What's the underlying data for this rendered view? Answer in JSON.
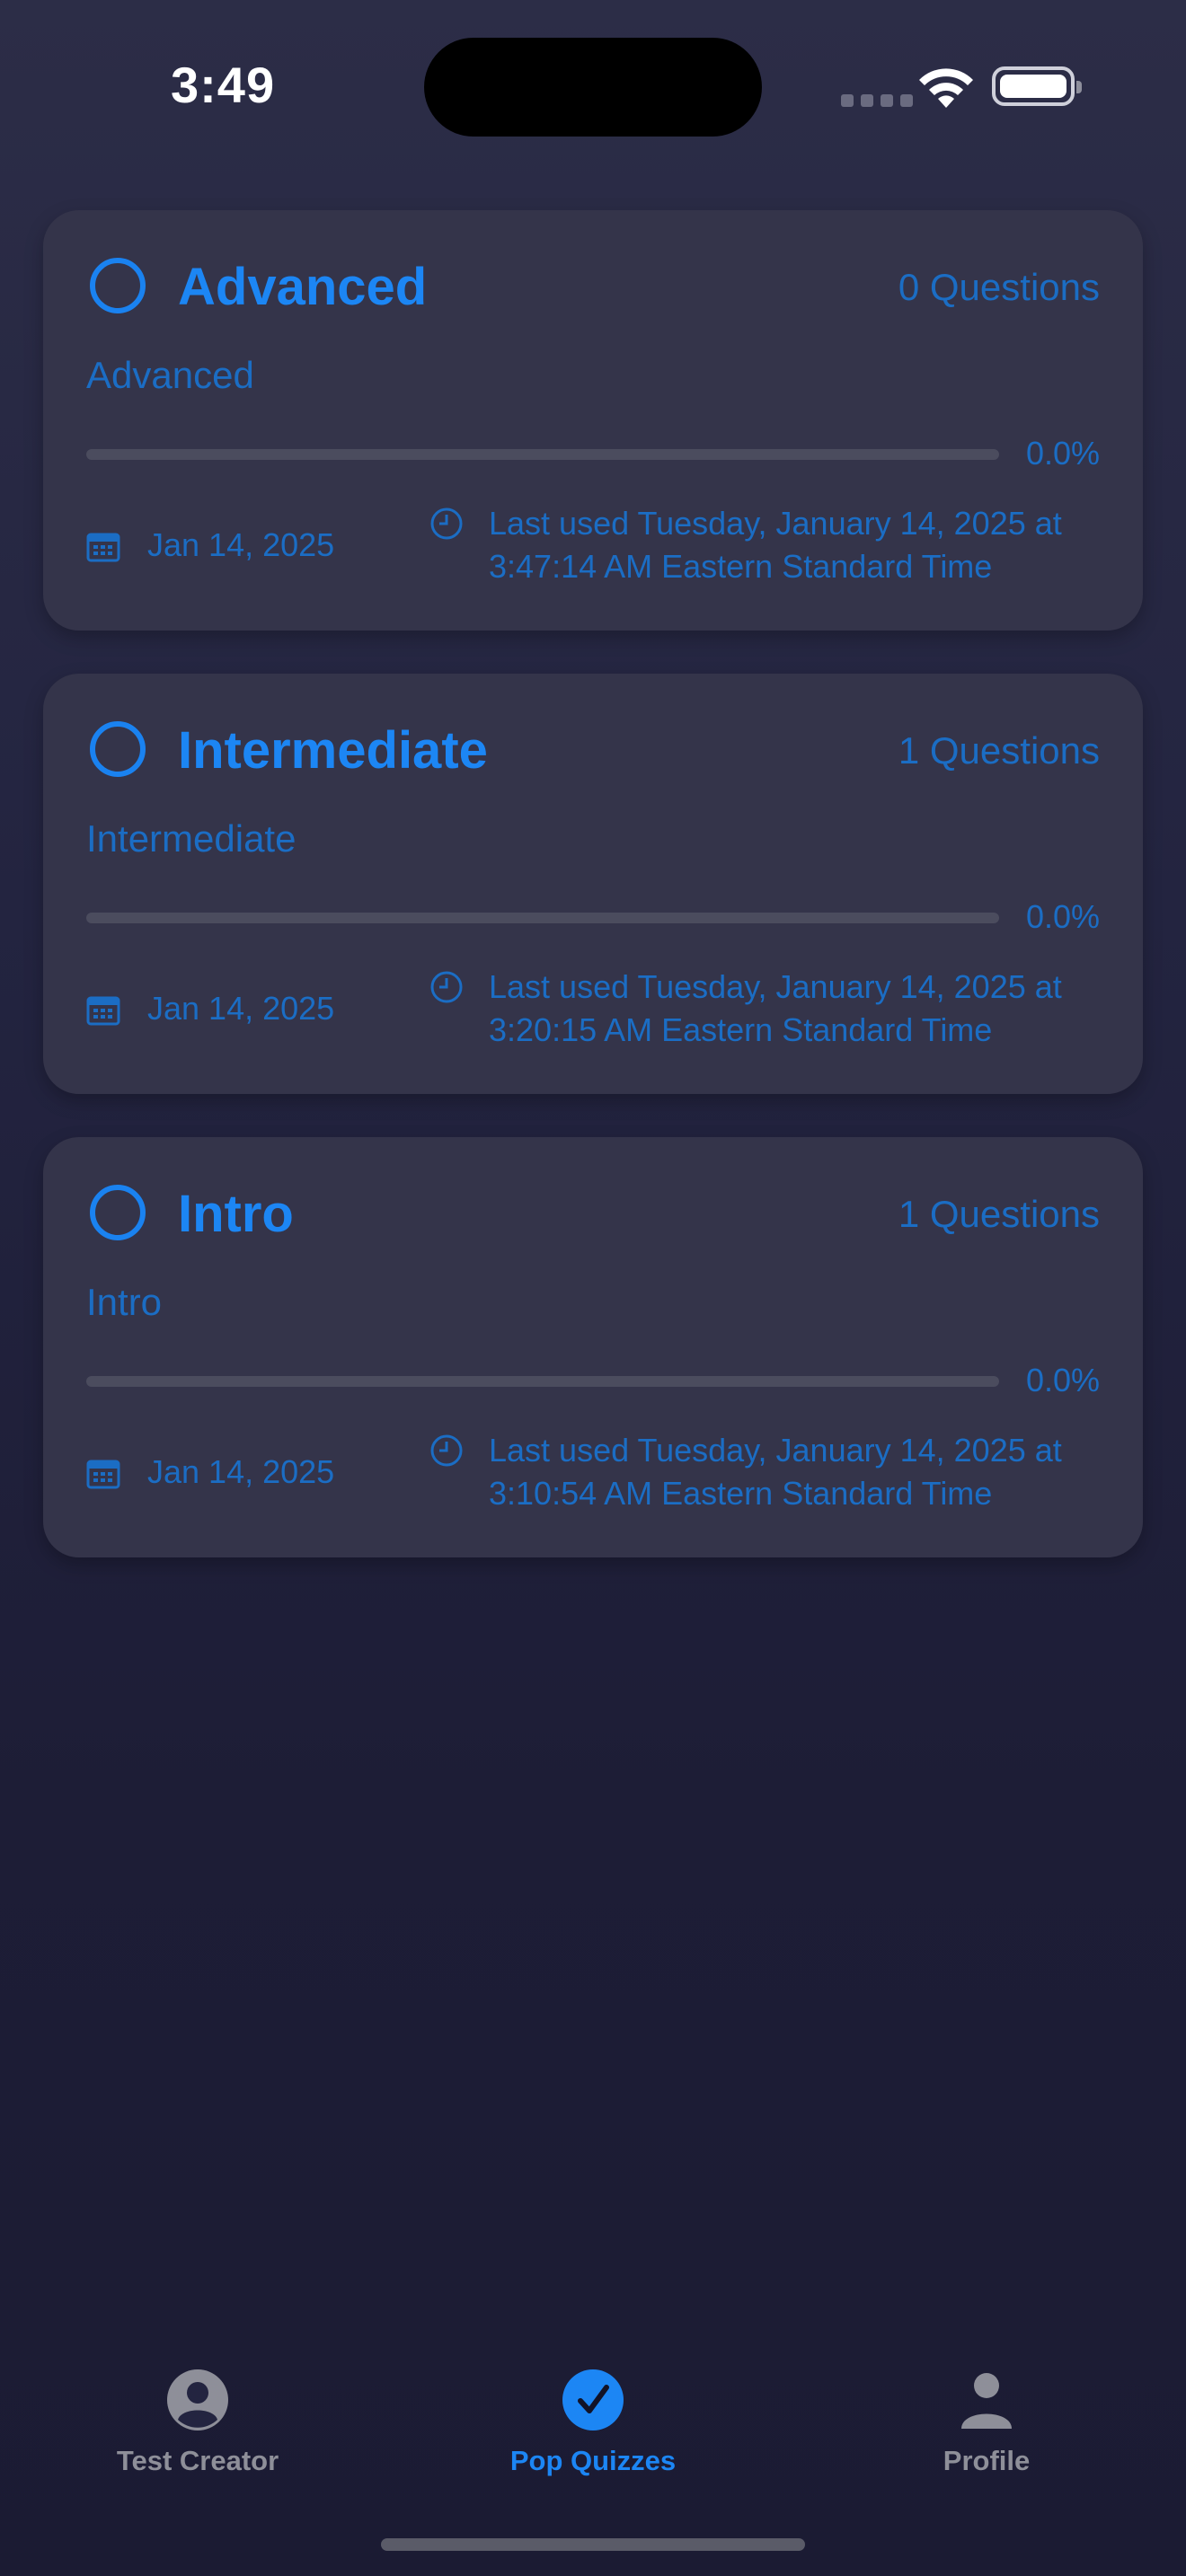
{
  "status_bar": {
    "time": "3:49"
  },
  "quizzes": [
    {
      "title": "Advanced",
      "questions": "0 Questions",
      "subtitle": "Advanced",
      "progress": 0.0,
      "progress_label": "0.0%",
      "date": "Jan 14, 2025",
      "last_used": "Last used Tuesday, January 14, 2025 at 3:47:14 AM Eastern Standard Time"
    },
    {
      "title": "Intermediate",
      "questions": "1 Questions",
      "subtitle": "Intermediate",
      "progress": 0.0,
      "progress_label": "0.0%",
      "date": "Jan 14, 2025",
      "last_used": "Last used Tuesday, January 14, 2025 at 3:20:15 AM Eastern Standard Time"
    },
    {
      "title": "Intro",
      "questions": "1 Questions",
      "subtitle": "Intro",
      "progress": 0.0,
      "progress_label": "0.0%",
      "date": "Jan 14, 2025",
      "last_used": "Last used Tuesday, January 14, 2025 at 3:10:54 AM Eastern Standard Time"
    }
  ],
  "tab_bar": {
    "tabs": [
      {
        "label": "Test Creator",
        "icon": "person-circle-icon",
        "active": false
      },
      {
        "label": "Pop Quizzes",
        "icon": "checkmark-circle-icon",
        "active": true
      },
      {
        "label": "Profile",
        "icon": "person-icon",
        "active": false
      }
    ]
  },
  "colors": {
    "accent": "#1c86f4",
    "card_background": "#34344a",
    "inactive_tab": "#8e8f99"
  }
}
